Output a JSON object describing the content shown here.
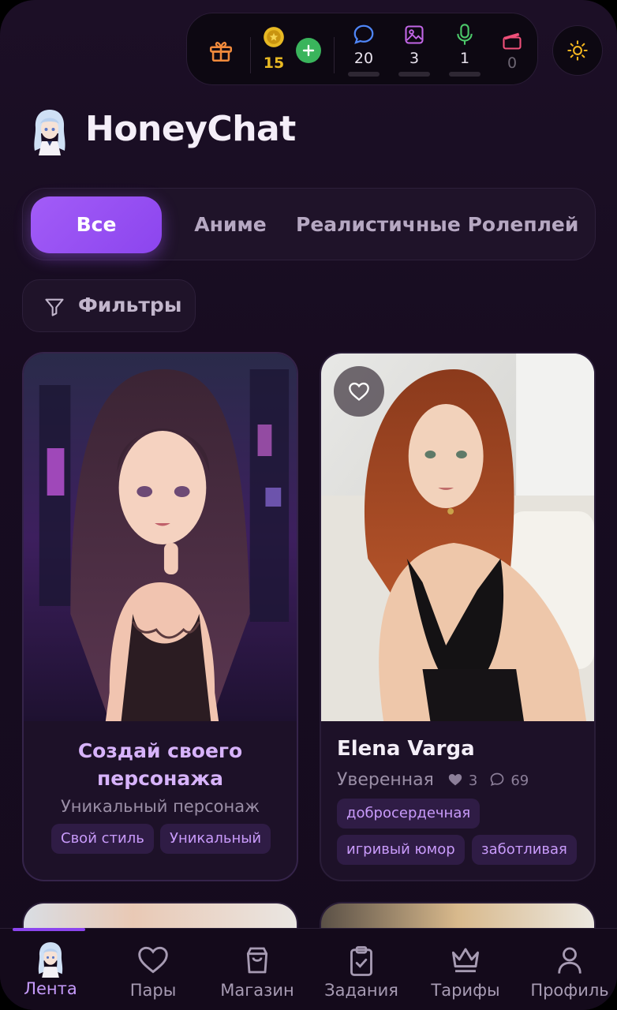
{
  "stats": {
    "coins": "15",
    "messages": "20",
    "images": "3",
    "voice": "1",
    "videos": "0"
  },
  "brand": {
    "name": "HoneyChat"
  },
  "tabs": [
    {
      "label": "Все",
      "active": true
    },
    {
      "label": "Аниме",
      "active": false
    },
    {
      "label": "Реалистичные",
      "active": false
    },
    {
      "label": "Ролеплей",
      "active": false
    }
  ],
  "filters": {
    "label": "Фильтры"
  },
  "cards": [
    {
      "title_line1": "Создай своего",
      "title_line2": "персонажа",
      "subtitle": "Уникальный персонаж",
      "tags": [
        "Свой стиль",
        "Уникальный"
      ]
    },
    {
      "name": "Elena Varga",
      "trait": "Уверенная",
      "likes": "3",
      "comments": "69",
      "tags": [
        "добросердечная",
        "игривый юмор",
        "заботливая"
      ]
    }
  ],
  "nav": [
    {
      "label": "Лента",
      "active": true
    },
    {
      "label": "Пары",
      "active": false
    },
    {
      "label": "Магазин",
      "active": false
    },
    {
      "label": "Задания",
      "active": false
    },
    {
      "label": "Тарифы",
      "active": false
    },
    {
      "label": "Профиль",
      "active": false
    }
  ],
  "colors": {
    "accent": "#8c45ee",
    "coin": "#e8b923",
    "plus": "#3ab45c",
    "message_icon": "#4f86f7",
    "image_icon": "#c266e6",
    "voice_icon": "#4cc96a",
    "video_icon": "#f0507a"
  }
}
